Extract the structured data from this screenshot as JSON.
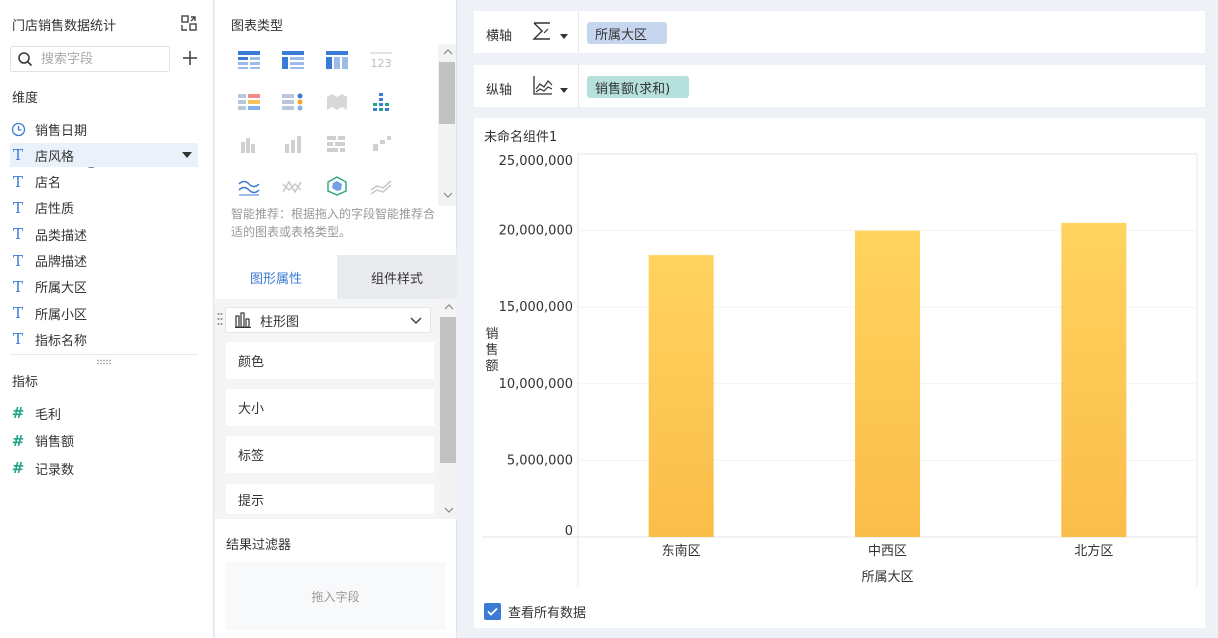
{
  "dataset": {
    "title": "门店销售数据统计",
    "search_placeholder": "搜索字段"
  },
  "dimensions": {
    "heading": "维度",
    "items": [
      {
        "label": "销售日期",
        "icon": "clock-icon"
      },
      {
        "label": "店风格",
        "icon": "text-field-icon"
      },
      {
        "label": "店名",
        "icon": "text-field-icon"
      },
      {
        "label": "店性质",
        "icon": "text-field-icon"
      },
      {
        "label": "品类描述",
        "icon": "text-field-icon"
      },
      {
        "label": "品牌描述",
        "icon": "text-field-icon"
      },
      {
        "label": "所属大区",
        "icon": "text-field-icon"
      },
      {
        "label": "所属小区",
        "icon": "text-field-icon"
      },
      {
        "label": "指标名称",
        "icon": "text-field-icon"
      }
    ]
  },
  "measures": {
    "heading": "指标",
    "items": [
      {
        "label": "毛利",
        "icon": "number-field-icon"
      },
      {
        "label": "销售额",
        "icon": "number-field-icon"
      },
      {
        "label": "记录数",
        "icon": "number-field-icon"
      }
    ]
  },
  "chart_types": {
    "heading": "图表类型",
    "tip": "智能推荐：根据拖入的字段智能推荐合适的图表或表格类型。"
  },
  "tabs": {
    "graph_props": "图形属性",
    "component_style": "组件样式"
  },
  "props": {
    "chart_type_label": "柱形图",
    "cards": [
      "颜色",
      "大小",
      "标签",
      "提示"
    ]
  },
  "filter": {
    "heading": "结果过滤器",
    "drop_hint": "拖入字段"
  },
  "axes": {
    "x_label": "横轴",
    "x_field": "所属大区",
    "y_label": "纵轴",
    "y_field": "销售额(求和)"
  },
  "widget": {
    "title": "未命名组件1",
    "view_all_label": "查看所有数据"
  },
  "colors": {
    "accent": "#3a7bd5",
    "bar_top": "#ffd35e",
    "bar_bottom": "#fbbd4a",
    "x_pill": "#c7d6ef",
    "y_pill": "#b6e0dc"
  },
  "chart_data": {
    "type": "bar",
    "categories": [
      "东南区",
      "中西区",
      "北方区"
    ],
    "series": [
      {
        "values": [
          18400000,
          20000000,
          20500000
        ]
      }
    ],
    "xlabel": "所属大区",
    "ylabel": "销售额",
    "ylim": [
      0,
      25000000
    ],
    "yticks": [
      "0",
      "5,000,000",
      "10,000,000",
      "15,000,000",
      "20,000,000",
      "25,000,000"
    ],
    "grid": true,
    "legend": "none"
  }
}
